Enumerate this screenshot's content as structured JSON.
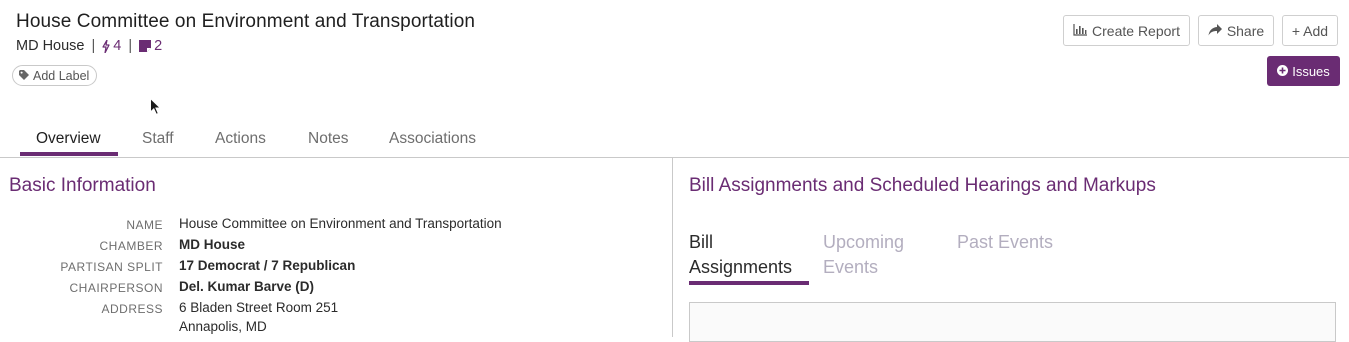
{
  "header": {
    "title": "House Committee on Environment and Transportation",
    "chamber": "MD House",
    "separator": "|",
    "actions_count": "4",
    "notes_count": "2",
    "add_label": "Add Label"
  },
  "toolbar": {
    "create_report": "Create Report",
    "share": "Share",
    "add": "+ Add",
    "issues": "Issues"
  },
  "tabs": [
    {
      "label": "Overview"
    },
    {
      "label": "Staff"
    },
    {
      "label": "Actions"
    },
    {
      "label": "Notes"
    },
    {
      "label": "Associations"
    }
  ],
  "basic_info": {
    "title": "Basic Information",
    "rows": [
      {
        "label": "NAME",
        "value": "House Committee on Environment and Transportation"
      },
      {
        "label": "CHAMBER",
        "value": "MD House"
      },
      {
        "label": "PARTISAN SPLIT",
        "value": "17 Democrat / 7 Republican"
      },
      {
        "label": "CHAIRPERSON",
        "value": "Del. Kumar Barve (D)"
      },
      {
        "label": "ADDRESS",
        "value": "6 Bladen Street Room 251",
        "value2": "Annapolis, MD"
      }
    ]
  },
  "bills": {
    "title": "Bill Assignments and Scheduled Hearings and Markups",
    "tabs": [
      {
        "line1": "Bill",
        "line2": "Assignments"
      },
      {
        "line1": "Upcoming",
        "line2": "Events"
      },
      {
        "line1": "Past Events",
        "line2": ""
      }
    ]
  },
  "colors": {
    "accent": "#6a2c73",
    "inactive_tab": "#b3aebf",
    "border": "#c9c9c9"
  },
  "icons": [
    "bolt-icon",
    "note-icon",
    "tag-icon",
    "bar-chart-icon",
    "share-icon",
    "plus-circle-icon",
    "mouse-cursor-icon"
  ]
}
